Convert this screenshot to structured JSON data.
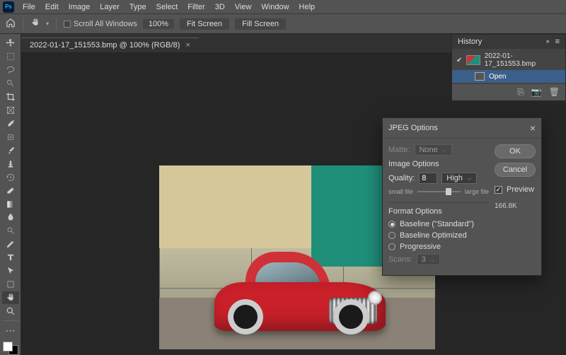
{
  "menubar": [
    "File",
    "Edit",
    "Image",
    "Layer",
    "Type",
    "Select",
    "Filter",
    "3D",
    "View",
    "Window",
    "Help"
  ],
  "optionsbar": {
    "scroll_all": "Scroll All Windows",
    "zoom": "100%",
    "fit_screen": "Fit Screen",
    "fill_screen": "Fill Screen"
  },
  "document_tab": {
    "title": "2022-01-17_151553.bmp @ 100% (RGB/8)"
  },
  "history_panel": {
    "title": "History",
    "snapshot": "2022-01-17_151553.bmp",
    "steps": [
      "Open"
    ]
  },
  "dialog": {
    "title": "JPEG Options",
    "matte_label": "Matte:",
    "matte_value": "None",
    "image_options_title": "Image Options",
    "quality_label": "Quality:",
    "quality_value": "8",
    "quality_preset": "High",
    "slider_small": "small file",
    "slider_large": "large file",
    "format_options_title": "Format Options",
    "opt_baseline_std": "Baseline (\"Standard\")",
    "opt_baseline_opt": "Baseline Optimized",
    "opt_progressive": "Progressive",
    "scans_label": "Scans:",
    "scans_value": "3",
    "ok": "OK",
    "cancel": "Cancel",
    "preview_label": "Preview",
    "filesize": "166.8K"
  }
}
